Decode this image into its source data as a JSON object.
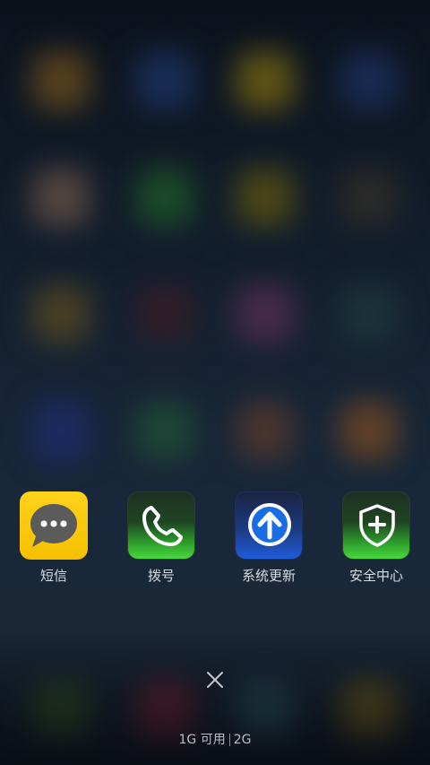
{
  "apps": [
    {
      "label": "短信",
      "icon": "message-bubble-icon",
      "tile_color": "#f6c000"
    },
    {
      "label": "拨号",
      "icon": "phone-handset-icon",
      "tile_color": "#3fd23a"
    },
    {
      "label": "系统更新",
      "icon": "upload-arrow-icon",
      "tile_color": "#1f6fe0"
    },
    {
      "label": "安全中心",
      "icon": "security-shield-icon",
      "tile_color": "#3fd23a"
    }
  ],
  "close": {
    "icon": "close-icon"
  },
  "memory": {
    "free_label": "1G 可用",
    "total_label": "2G"
  }
}
